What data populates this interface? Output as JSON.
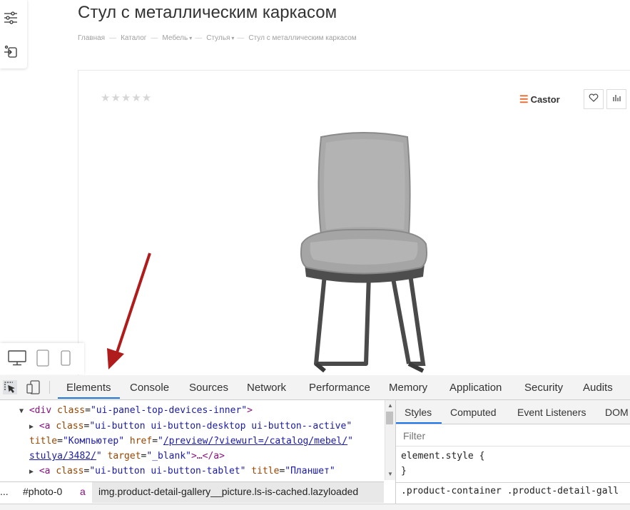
{
  "page": {
    "title": "Стул с металлическим каркасом",
    "breadcrumbs": [
      {
        "label": "Главная",
        "caret": false
      },
      {
        "label": "Каталог",
        "caret": false
      },
      {
        "label": "Мебель",
        "caret": true
      },
      {
        "label": "Стулья",
        "caret": true
      },
      {
        "label": "Стул с металлическим каркасом",
        "caret": false
      }
    ],
    "separator": "—",
    "caret_glyph": "▾"
  },
  "product": {
    "stars": "★★★★★",
    "rating": 0,
    "brand_logo": "☰",
    "brand": "Castor",
    "icons": [
      "heart-icon",
      "compare-chart-icon"
    ]
  },
  "left_panel": {
    "icons": [
      "filter-sliders-icon",
      "login-icon"
    ]
  },
  "device_bar": {
    "icons": [
      "desktop-icon",
      "tablet-icon",
      "mobile-icon"
    ]
  },
  "devtools": {
    "tabs": [
      "Elements",
      "Console",
      "Sources",
      "Network",
      "Performance",
      "Memory",
      "Application",
      "Security",
      "Audits"
    ],
    "active_tab": "Elements",
    "code": {
      "l1_tag_open": "<div ",
      "l1_attr": "class",
      "l1_val": "\"ui-panel-top-devices-inner\"",
      "l1_close": ">",
      "l2_tag_open": "<a ",
      "l2_attr": "class",
      "l2_val": "\"ui-button ui-button-desktop ui-button--active\"",
      "l3_attr1": "title",
      "l3_val1": "\"Компьютер\"",
      "l3_attr2": "href",
      "l3_val2_q": "\"",
      "l3_link1": "/preview/?viewurl=/catalog/mebel/",
      "l4_link2": "stulya/3482/",
      "l4_val_end": "\"",
      "l4_attr3": "target",
      "l4_val3": "\"_blank\"",
      "l4_end": ">…</a>",
      "l5_tag_open": "<a ",
      "l5_attr1": "class",
      "l5_val1": "\"ui-button ui-button-tablet\"",
      "l5_attr2": "title",
      "l5_val2": "\"Планшет\""
    },
    "styles_tabs": [
      "Styles",
      "Computed",
      "Event Listeners",
      "DOM"
    ],
    "filter_placeholder": "Filter",
    "element_style_open": "element.style {",
    "element_style_close": "}",
    "rule2": ".product-container .product-detail-gall",
    "breadcrumb_bar": {
      "ellipsis": "...",
      "item1": "#photo-0",
      "item2": "a",
      "item3": "img.product-detail-gallery__picture.ls-is-cached.lazyloaded"
    }
  },
  "annotation": {
    "arrow_color": "#b01c1c"
  }
}
